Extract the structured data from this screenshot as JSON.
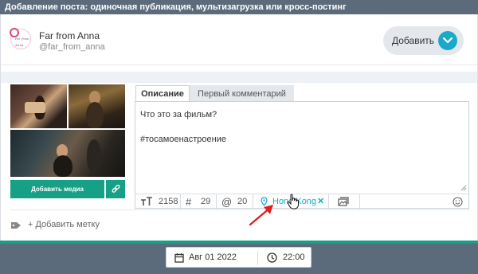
{
  "header": {
    "title": "Добавление поста: одиночная публикация, мультизагрузка или кросс-постинг"
  },
  "account": {
    "name": "Far from Anna",
    "handle": "@far_from_anna",
    "avatar_text": "Far from Anna"
  },
  "add_button": {
    "label": "Добавить"
  },
  "media": {
    "add_label": "Добавить медиа"
  },
  "tabs": [
    {
      "label": "Описание",
      "active": true
    },
    {
      "label": "Первый комментарий",
      "active": false
    }
  ],
  "editor": {
    "line1": "Что это за фильм?",
    "line2": "#тосамоенастроение"
  },
  "footer": {
    "char_count": "2158",
    "hashtag_count": "29",
    "mention_count": "20",
    "location": "Hong Kong"
  },
  "labels": {
    "add_label": "+ Добавить метку"
  },
  "schedule": {
    "date": "Авг 01 2022",
    "time": "22:00"
  },
  "colors": {
    "accent": "#1aa9c9",
    "green": "#16a085",
    "topbar": "#5c6b7c",
    "arrow": "#e02020"
  }
}
